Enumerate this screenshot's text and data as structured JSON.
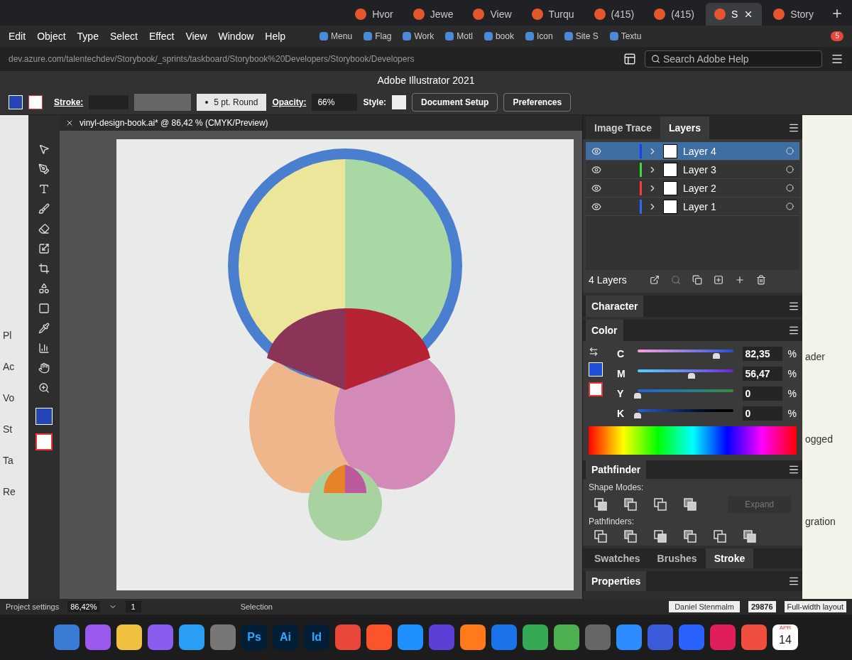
{
  "browser_tabs": [
    {
      "label": "Hvor",
      "selected": false
    },
    {
      "label": "Jewe",
      "selected": false
    },
    {
      "label": "View",
      "selected": false
    },
    {
      "label": "Turqu",
      "selected": false
    },
    {
      "label": "(415)",
      "selected": false
    },
    {
      "label": "(415)",
      "selected": false
    },
    {
      "label": "S",
      "selected": true
    },
    {
      "label": "Story",
      "selected": false
    }
  ],
  "menu_bar": [
    "Edit",
    "Object",
    "Type",
    "Select",
    "Effect",
    "View",
    "Window",
    "Help"
  ],
  "bookmarks": [
    "Menu",
    "Flag",
    "Work",
    "Motl",
    "book",
    "Icon",
    "Site S",
    "Textu"
  ],
  "extension_badge": "5",
  "address_bar": {
    "url": "dev.azure.com/talentechdev/Storybook/_sprints/taskboard/Storybook%20Developers/Storybook/Developers"
  },
  "help_search": {
    "placeholder": "Search Adobe Help"
  },
  "window": {
    "title": "Adobe Illustrator 2021"
  },
  "control_bar": {
    "stroke_label": "Stroke:",
    "brush": "5 pt. Round",
    "opacity_label": "Opacity:",
    "opacity": "66%",
    "style_label": "Style:",
    "buttons": [
      "Document Setup",
      "Preferences"
    ]
  },
  "document_tab": {
    "title": "vinyl-design-book.ai* @ 86,42 % (CMYK/Preview)"
  },
  "layers_panel": {
    "tabs": [
      {
        "label": "Image Trace",
        "selected": false
      },
      {
        "label": "Layers",
        "selected": true
      }
    ],
    "layers": [
      {
        "name": "Layer 4",
        "color": "#1a3cff",
        "visible": true,
        "selected": true
      },
      {
        "name": "Layer 3",
        "color": "#3ddc2e",
        "visible": true,
        "selected": false
      },
      {
        "name": "Layer 2",
        "color": "#ff3a3a",
        "visible": true,
        "selected": false
      },
      {
        "name": "Layer 1",
        "color": "#2a6bff",
        "visible": true,
        "selected": false
      }
    ],
    "count": "4 Layers"
  },
  "character_panel": {
    "title": "Character"
  },
  "color_panel": {
    "title": "Color",
    "channels": [
      {
        "name": "C",
        "level": 0.8235,
        "value": "82,35",
        "unit": "%"
      },
      {
        "name": "M",
        "level": 0.5647,
        "value": "56,47",
        "unit": "%"
      },
      {
        "name": "Y",
        "level": 0,
        "value": "0",
        "unit": "%"
      },
      {
        "name": "K",
        "level": 0,
        "value": "0",
        "unit": "%"
      }
    ]
  },
  "pathfinder_panel": {
    "title": "Pathfinder",
    "shape_modes_label": "Shape Modes:",
    "pathfinders_label": "Pathfinders:",
    "expand": {
      "label": "Expand",
      "disabled": true
    }
  },
  "bottom_tabs": [
    {
      "label": "Swatches",
      "selected": false
    },
    {
      "label": "Brushes",
      "selected": false
    },
    {
      "label": "Stroke",
      "selected": true
    }
  ],
  "properties_tab": "Properties",
  "status_bar": {
    "project": "Project settings",
    "zoom": "86,42%",
    "artboard": "1",
    "tool": "Selection"
  },
  "side_nav": [
    "Pl",
    "Ac",
    "Vo",
    "St",
    "Ta",
    "Re"
  ],
  "background_page": {
    "texts": [
      "ader",
      "ogged",
      "gration"
    ],
    "user": "Daniel Stenmalm",
    "work_item": {
      "id": "29876",
      "title": "Full-width layout"
    }
  },
  "dock": {
    "apps": [
      "Ps",
      "Ai",
      "Id"
    ],
    "calendar": {
      "month": "APR",
      "day": "14"
    }
  }
}
